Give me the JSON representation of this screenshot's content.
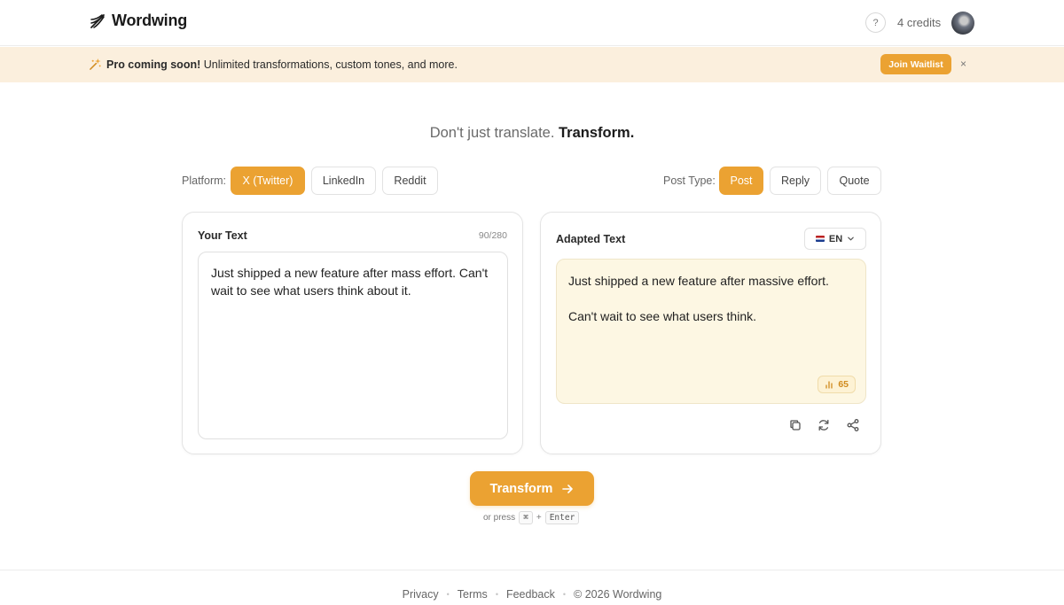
{
  "header": {
    "brand": "Wordwing",
    "help_label": "?",
    "credits": "4 credits"
  },
  "banner": {
    "highlight": "Pro coming soon!",
    "text": " Unlimited transformations, custom tones, and more.",
    "button_label": "Join Waitlist",
    "close_label": "×"
  },
  "tagline": {
    "lead": "Don't just translate.",
    "emphasis": "Transform."
  },
  "platform": {
    "label": "Platform:",
    "options": [
      "X (Twitter)",
      "LinkedIn",
      "Reddit"
    ],
    "selected": "X (Twitter)"
  },
  "post_type": {
    "label": "Post Type:",
    "options": [
      "Post",
      "Reply",
      "Quote"
    ],
    "selected": "Post"
  },
  "input_card": {
    "title": "Your Text",
    "counter": "90/280",
    "value": "Just shipped a new feature after mass effort. Can't wait to see what users think about it."
  },
  "output_card": {
    "title": "Adapted Text",
    "language": "EN",
    "paragraphs": [
      "Just shipped a new feature after massive effort.",
      "Can't wait to see what users think."
    ],
    "score": "65"
  },
  "transform": {
    "button_label": "Transform",
    "hint_prefix": "or press",
    "key_cmd": "⌘",
    "plus": "+",
    "key_enter": "Enter"
  },
  "footer": {
    "links": [
      "Privacy",
      "Terms",
      "Feedback"
    ],
    "copyright": "© 2026 Wordwing"
  },
  "colors": {
    "accent": "#eba232",
    "banner_bg": "#fbefdd",
    "output_bg": "#fdf7e3"
  },
  "icons": {
    "logo": "wing-icon",
    "banner": "sparkle-icon",
    "lang": "chevron-down-icon",
    "score": "bar-chart-icon",
    "actions": [
      "copy-icon",
      "refresh-icon",
      "share-icon"
    ],
    "transform": "arrow-right-icon"
  }
}
